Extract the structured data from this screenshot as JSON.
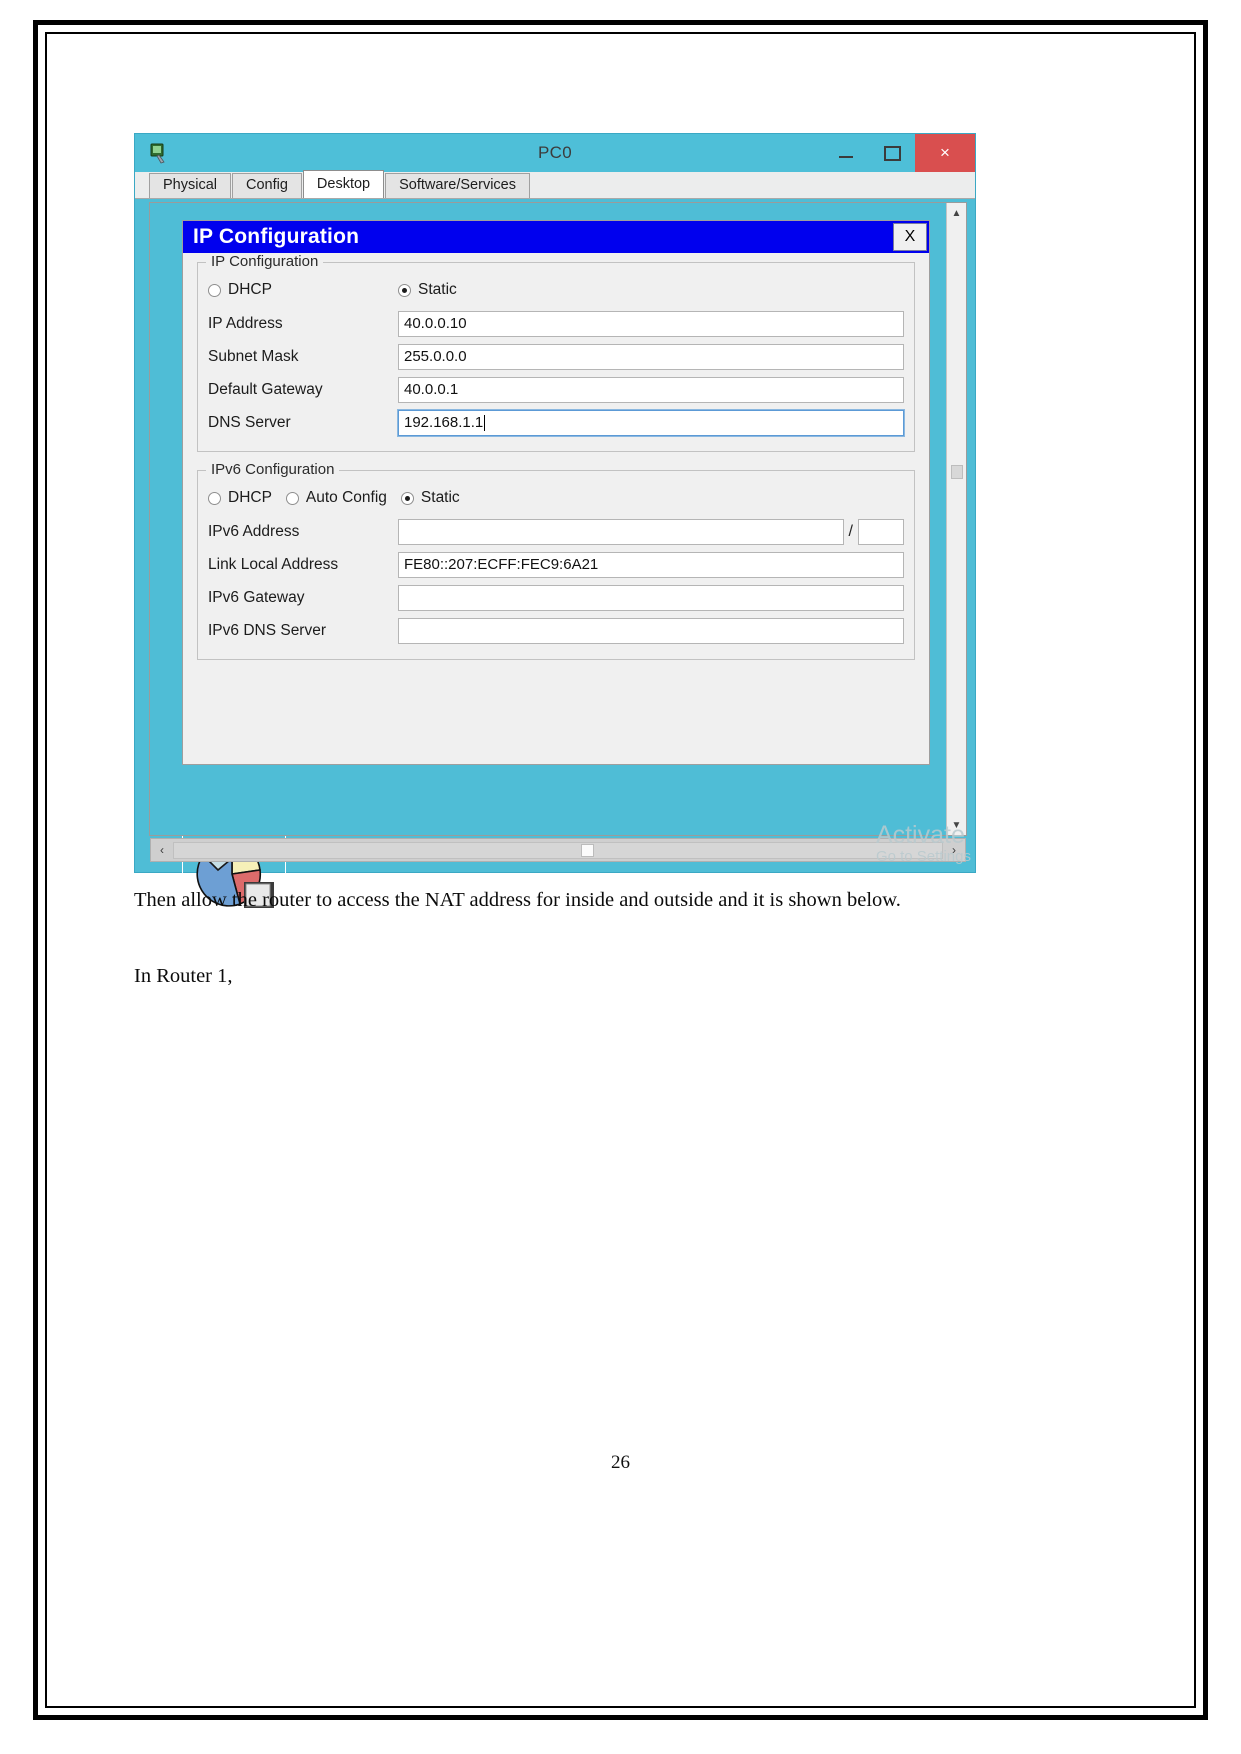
{
  "document": {
    "paragraph_1": "Then allow the router to access the NAT address for inside and outside and it is shown below.",
    "paragraph_2": "In Router 1,",
    "page_number": "26"
  },
  "screenshot": {
    "window": {
      "title": "PC0",
      "icon": "packet-tracer-pc-icon",
      "controls": {
        "minimize": "minimize-icon",
        "maximize": "maximize-icon",
        "close": "×"
      }
    },
    "tabs": [
      {
        "label": "Physical",
        "active": false
      },
      {
        "label": "Config",
        "active": false
      },
      {
        "label": "Desktop",
        "active": true
      },
      {
        "label": "Software/Services",
        "active": false
      }
    ],
    "dialog": {
      "title": "IP Configuration",
      "close_label": "X",
      "ipv4": {
        "legend": "IP Configuration",
        "modes": [
          {
            "label": "DHCP",
            "selected": false
          },
          {
            "label": "Static",
            "selected": true
          }
        ],
        "fields": [
          {
            "label": "IP Address",
            "value": "40.0.0.10",
            "focused": false
          },
          {
            "label": "Subnet Mask",
            "value": "255.0.0.0",
            "focused": false
          },
          {
            "label": "Default Gateway",
            "value": "40.0.0.1",
            "focused": false
          },
          {
            "label": "DNS Server",
            "value": "192.168.1.1",
            "focused": true
          }
        ]
      },
      "ipv6": {
        "legend": "IPv6 Configuration",
        "modes": [
          {
            "label": "DHCP",
            "selected": false
          },
          {
            "label": "Auto Config",
            "selected": false
          },
          {
            "label": "Static",
            "selected": true
          }
        ],
        "address_row": {
          "label": "IPv6 Address",
          "value": "",
          "separator": "/",
          "prefix": ""
        },
        "fields": [
          {
            "label": "Link Local Address",
            "value": "FE80::207:ECFF:FEC9:6A21"
          },
          {
            "label": "IPv6 Gateway",
            "value": ""
          },
          {
            "label": "IPv6 DNS Server",
            "value": ""
          }
        ]
      }
    },
    "taskbar": {
      "pie_icon": "pie-chart-icon"
    },
    "scrollbars": {
      "vertical": {
        "up": "▲",
        "down": "▼"
      },
      "horizontal": {
        "left": "‹",
        "right": "›"
      }
    },
    "watermark": {
      "line1": "Activate",
      "line2": "Go to Settings"
    }
  },
  "colors": {
    "window_chrome": "#4fbdd6",
    "dialog_title_bar": "#0000ee",
    "close_button": "#d94f4f",
    "focus_border": "#5c9ad6"
  }
}
